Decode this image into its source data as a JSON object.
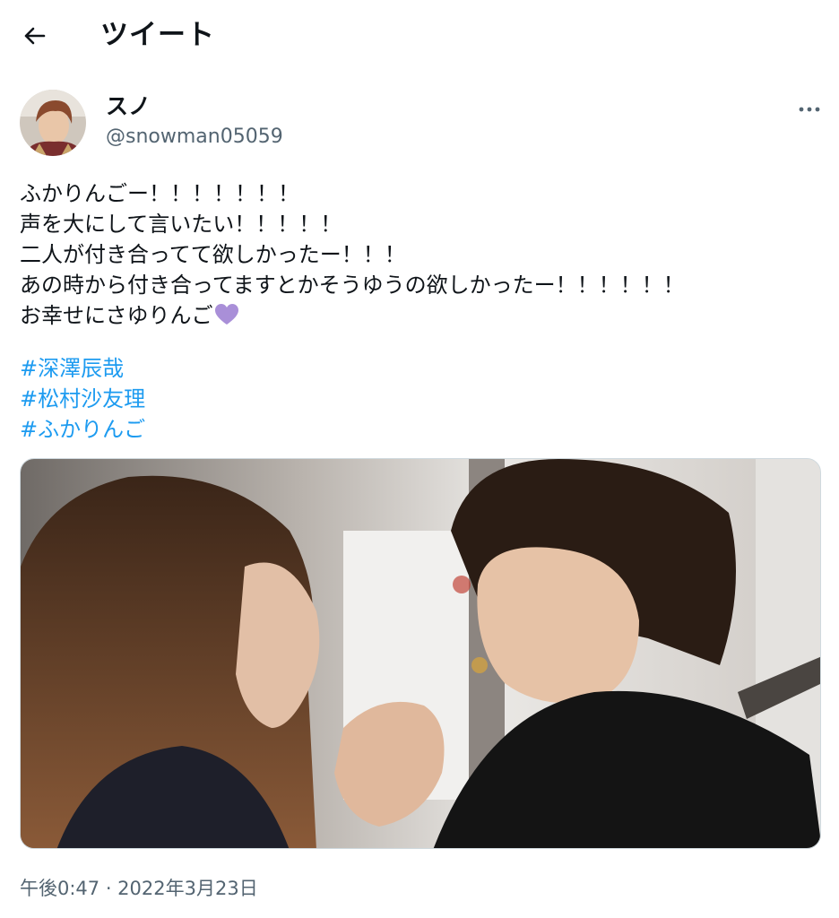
{
  "header": {
    "title": "ツイート",
    "back_icon": "arrow-left-icon"
  },
  "user": {
    "display_name": "スノ",
    "handle": "@snowman05059",
    "more_icon": "more-dots-icon"
  },
  "tweet": {
    "lines": [
      "ふかりんごー！！！！！！！",
      "声を大にして言いたい！！！！！",
      "二人が付き合ってて欲しかったー！！！",
      "あの時から付き合ってますとかそうゆうの欲しかったー！！！！！！",
      "お幸せにさゆりんご"
    ],
    "emoji": "purple-heart-icon",
    "hashtags": [
      "#深澤辰哉",
      "#松村沙友理",
      "#ふかりんご"
    ],
    "timestamp": "午後0:47 · 2022年3月23日"
  },
  "colors": {
    "text": "#0f1419",
    "secondary": "#536471",
    "link": "#1d9bf0",
    "heart": "#a98fd8"
  }
}
